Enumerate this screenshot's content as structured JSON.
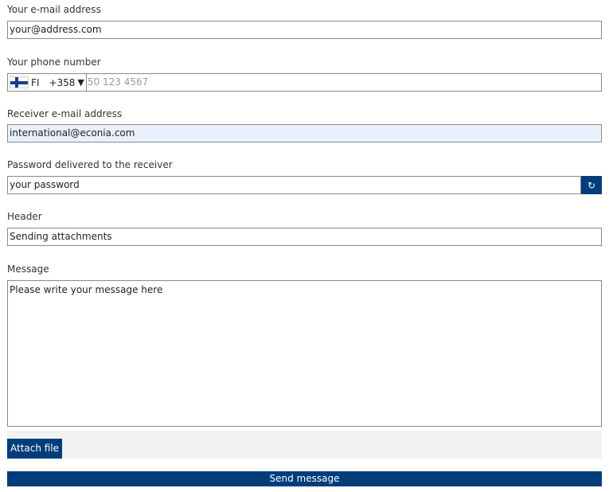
{
  "email": {
    "label": "Your e-mail address",
    "value": "your@address.com"
  },
  "phone": {
    "label": "Your phone number",
    "country_code": "FI",
    "dial_code": "+358",
    "caret": "▼",
    "placeholder": "50 123 4567",
    "flag_icon": "finland-flag-icon"
  },
  "receiver": {
    "label": "Receiver e-mail address",
    "value": "international@econia.com"
  },
  "password": {
    "label": "Password delivered to the receiver",
    "value": "your password",
    "refresh_glyph": "↻",
    "refresh_icon": "refresh-icon"
  },
  "header": {
    "label": "Header",
    "value": "Sending attachments"
  },
  "message": {
    "label": "Message",
    "value": "Please write your message here"
  },
  "actions": {
    "attach_label": "Attach file",
    "send_label": "Send message"
  },
  "colors": {
    "primary": "#003d7a",
    "readonly_bg": "#e8f0fe",
    "attach_bar_bg": "#f2f2f2"
  }
}
